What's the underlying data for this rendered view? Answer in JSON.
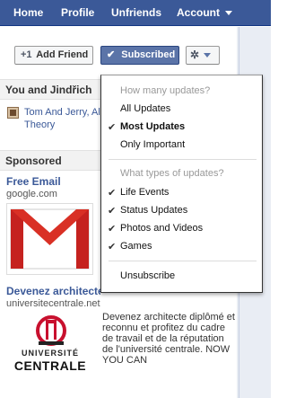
{
  "nav": {
    "home": "Home",
    "profile": "Profile",
    "unfriends": "Unfriends",
    "account": "Account"
  },
  "actions": {
    "add_friend": "Add Friend",
    "subscribed": "Subscribed"
  },
  "sidebar": {
    "you_and": "You and Jindřich",
    "shared_like": "Tom And Jerry, Al Theory",
    "sponsored": "Sponsored"
  },
  "ads": [
    {
      "title": "Free Email",
      "url": "google.com"
    },
    {
      "title": "Devenez architecte",
      "url": "universitecentrale.net",
      "text": "Devenez architecte diplômé et reconnu et profitez du cadre de travail et de la réputation de l'université centrale. NOW YOU CAN",
      "logo_line1": "UNIVERSITÉ",
      "logo_line2": "CENTRALE"
    }
  ],
  "menu": {
    "heading_updates": "How many updates?",
    "all_updates": "All Updates",
    "most_updates": "Most Updates",
    "only_important": "Only Important",
    "heading_types": "What types of updates?",
    "life_events": "Life Events",
    "status_updates": "Status Updates",
    "photos_videos": "Photos and Videos",
    "games": "Games",
    "unsubscribe": "Unsubscribe"
  },
  "colors": {
    "brand": "#3b5998",
    "subscribed_button": "#5b74a8"
  }
}
